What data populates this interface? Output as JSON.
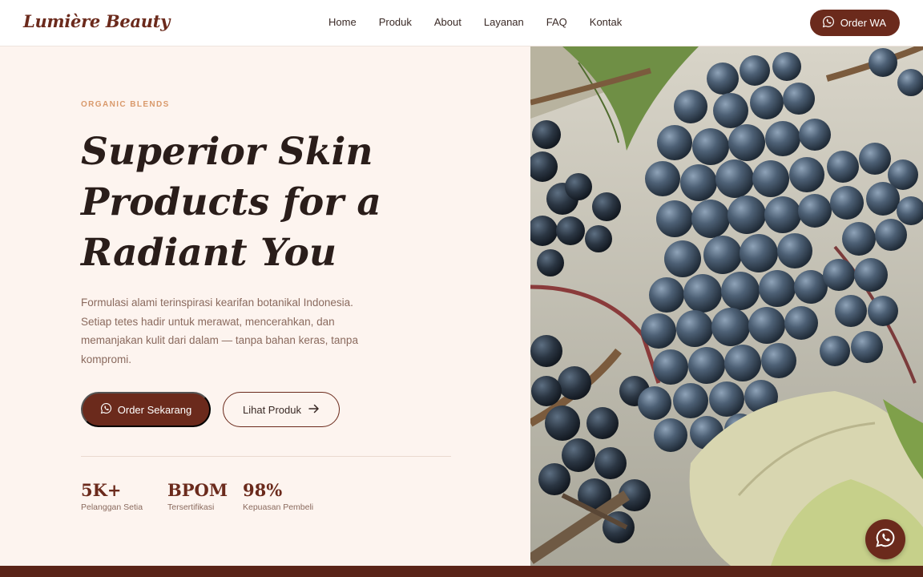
{
  "brand": "Lumière Beauty",
  "nav": [
    "Home",
    "Produk",
    "About",
    "Layanan",
    "FAQ",
    "Kontak"
  ],
  "header_cta": "Order WA",
  "hero": {
    "eyebrow": "ORGANIC BLENDS",
    "headline_lines": [
      "Superior Skin",
      "Products for a",
      "Radiant You"
    ],
    "description": "Formulasi alami terinspirasi kearifan botanikal Indonesia. Setiap tetes hadir untuk merawat, mencerahkan, dan memanjakan kulit dari dalam — tanpa bahan keras, tanpa kompromi.",
    "primary_button": "Order Sekarang",
    "secondary_button": "Lihat Produk",
    "stats": [
      {
        "value": "5K+",
        "label": "Pelanggan Setia"
      },
      {
        "value": "BPOM",
        "label": "Tersertifikasi"
      },
      {
        "value": "98%",
        "label": "Kepuasan Pembeli"
      }
    ]
  },
  "colors": {
    "brand": "#6b2a1c",
    "background": "#fdf4ef",
    "accent": "#d9996b"
  },
  "icons": {
    "whatsapp": "whatsapp-icon",
    "arrow": "arrow-right-icon",
    "hero_image": "grapes-photo"
  }
}
